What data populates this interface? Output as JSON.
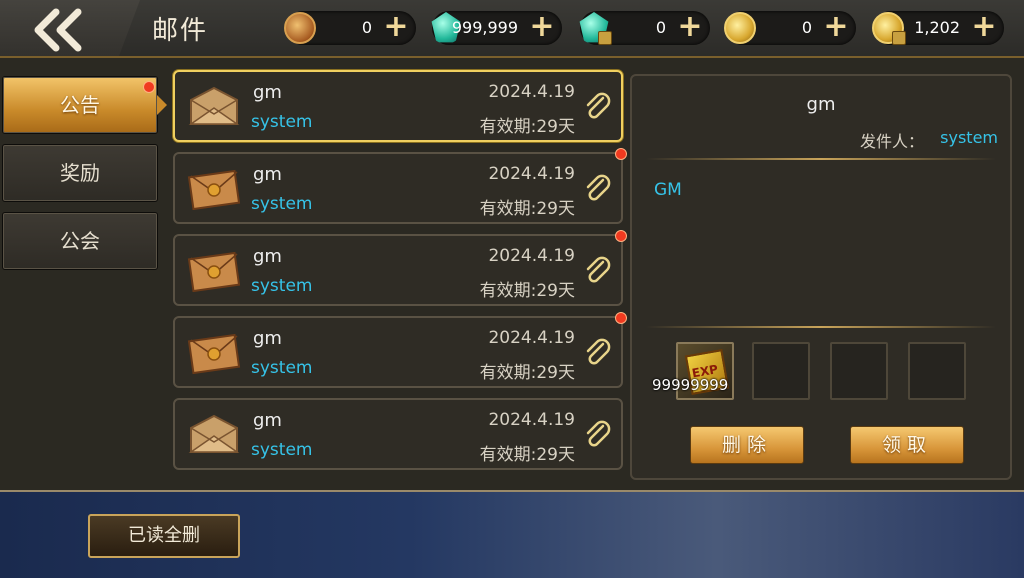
{
  "header": {
    "title": "邮件",
    "currencies": [
      {
        "icon": "bronze-coin-icon",
        "value": "0"
      },
      {
        "icon": "green-gem-icon",
        "value": "999,999"
      },
      {
        "icon": "locked-gem-icon",
        "value": "0"
      },
      {
        "icon": "gold-coin-icon",
        "value": "0"
      },
      {
        "icon": "locked-gold-coin-icon",
        "value": "1,202"
      }
    ],
    "plus_symbol": "+"
  },
  "tabs": [
    {
      "label": "公告",
      "active": true,
      "badge": true
    },
    {
      "label": "奖励",
      "active": false,
      "badge": false
    },
    {
      "label": "公会",
      "active": false,
      "badge": false
    }
  ],
  "mails": [
    {
      "sender": "gm",
      "from": "system",
      "date": "2024.4.19",
      "expiry": "有效期:29天",
      "opened": true,
      "selected": true,
      "unread_dot": false
    },
    {
      "sender": "gm",
      "from": "system",
      "date": "2024.4.19",
      "expiry": "有效期:29天",
      "opened": false,
      "selected": false,
      "unread_dot": true
    },
    {
      "sender": "gm",
      "from": "system",
      "date": "2024.4.19",
      "expiry": "有效期:29天",
      "opened": false,
      "selected": false,
      "unread_dot": true
    },
    {
      "sender": "gm",
      "from": "system",
      "date": "2024.4.19",
      "expiry": "有效期:29天",
      "opened": false,
      "selected": false,
      "unread_dot": true
    },
    {
      "sender": "gm",
      "from": "system",
      "date": "2024.4.19",
      "expiry": "有效期:29天",
      "opened": true,
      "selected": false,
      "unread_dot": false
    }
  ],
  "detail": {
    "sender": "gm",
    "from_label": "发件人：",
    "from": "system",
    "body": "GM",
    "attachment": {
      "icon": "exp-book-icon",
      "label": "EXP",
      "count": "99999999"
    },
    "delete_label": "删除",
    "claim_label": "领取"
  },
  "footer": {
    "read_all_delete_label": "已读全删"
  },
  "colors": {
    "accent_gold": "#f0d060",
    "link_cyan": "#36c3e8",
    "badge_red": "#f03a20"
  }
}
